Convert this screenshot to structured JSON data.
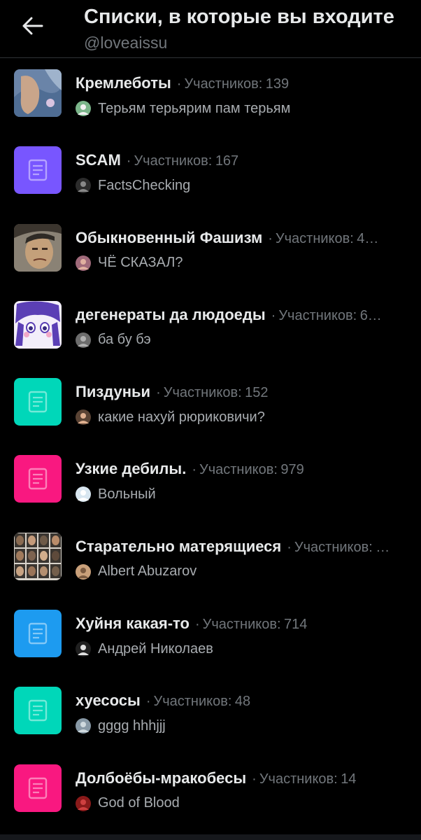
{
  "header": {
    "title": "Списки, в которые вы входите",
    "handle": "@loveaissu"
  },
  "members_label": "Участников:",
  "dot": "·",
  "lists": [
    {
      "name": "Кремлеботы",
      "members": "139",
      "owner": "Терьям терьярим пам терьям",
      "thumb": "photo-feet",
      "owner_avatar": "cat-avatar"
    },
    {
      "name": "SCAM",
      "members": "167",
      "owner": "FactsChecking",
      "thumb": "list-icon",
      "color": "#7856ff",
      "owner_avatar": "dark-avatar"
    },
    {
      "name": "Обыкновенный Фашизм",
      "members": "4…",
      "owner": "ЧЁ СКАЗАЛ?",
      "thumb": "photo-face",
      "owner_avatar": "face-avatar"
    },
    {
      "name": "дегенераты да людоеды",
      "members": "6…",
      "owner": "ба бу бэ",
      "thumb": "photo-drawing",
      "owner_avatar": "grey-avatar"
    },
    {
      "name": "Пиздуньи",
      "members": "152",
      "owner": "какие нахуй рюриковичи?",
      "thumb": "list-icon",
      "color": "#00d7b9",
      "owner_avatar": "person-avatar"
    },
    {
      "name": "Узкие дебилы.",
      "members": "979",
      "owner": "Вольный",
      "thumb": "list-icon",
      "color": "#f91880",
      "owner_avatar": "egg-avatar"
    },
    {
      "name": "Старательно матерящиеся",
      "members": "…",
      "owner": "Albert Abuzarov",
      "thumb": "photo-collage",
      "owner_avatar": "man-avatar"
    },
    {
      "name": "Хуйня какая-то",
      "members": "714",
      "owner": "Андрей Николаев",
      "thumb": "list-icon",
      "color": "#1d9bf0",
      "owner_avatar": "sketch-avatar"
    },
    {
      "name": "хуесосы",
      "members": "48",
      "owner": "gggg hhhjjj",
      "thumb": "list-icon",
      "color": "#00d7b9",
      "owner_avatar": "default-avatar"
    },
    {
      "name": "Долбоёбы-мракобесы",
      "members": "14",
      "owner": "God of Blood",
      "thumb": "list-icon",
      "color": "#f91880",
      "owner_avatar": "red-avatar"
    }
  ],
  "colors": {
    "background": "#000000",
    "text_primary": "#e7e9ea",
    "text_secondary": "#71767b",
    "divider": "#2f3336"
  }
}
